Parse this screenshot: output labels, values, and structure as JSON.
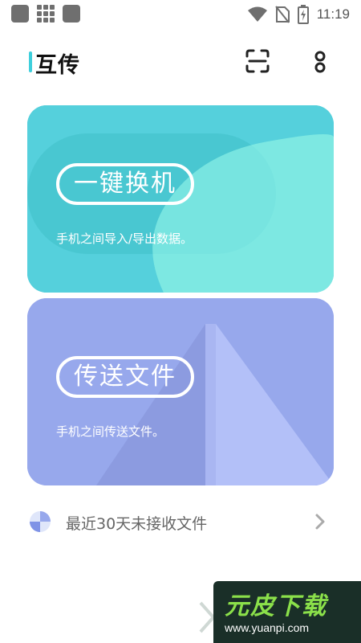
{
  "status_bar": {
    "time": "11:19",
    "icons": [
      "app-notification-icon",
      "grid-icon",
      "app-notification-icon",
      "wifi-icon",
      "no-sim-icon",
      "battery-charging-icon"
    ]
  },
  "header": {
    "title": "互传",
    "scan_icon": "scan-icon",
    "more_icon": "more-vertical-icon",
    "accent_color": "#3ecfdc"
  },
  "cards": [
    {
      "title": "一键换机",
      "description": "手机之间导入/导出数据。",
      "color": "#4bcad8"
    },
    {
      "title": "传送文件",
      "description": "手机之间传送文件。",
      "color": "#97a8ec"
    }
  ],
  "recent": {
    "label": "最近30天未接收文件",
    "icon": "pie-clock-icon",
    "chevron": "chevron-right-icon"
  },
  "watermark": {
    "brand": "元皮下载",
    "url": "www.yuanpi.com"
  }
}
